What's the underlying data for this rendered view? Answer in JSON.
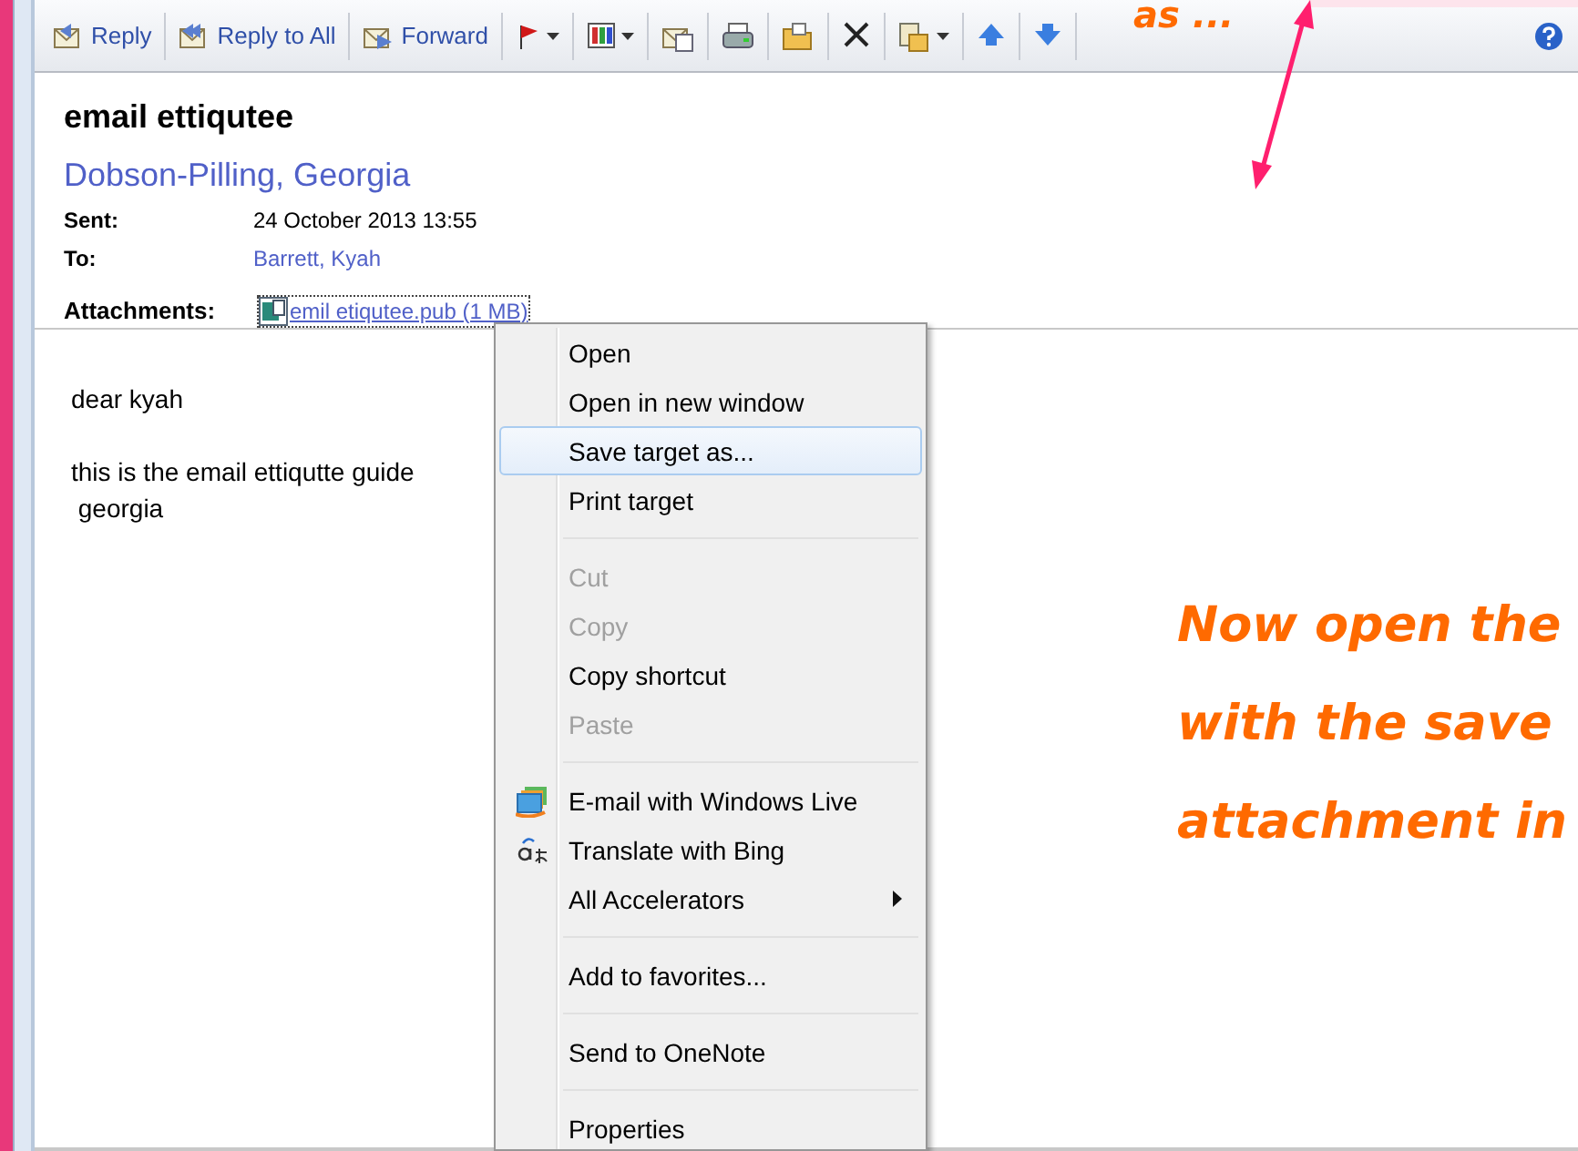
{
  "toolbar": {
    "buttons": [
      {
        "kind": "reply",
        "label": "Reply",
        "dropdown": false
      },
      {
        "kind": "reply-all",
        "label": "Reply to All",
        "dropdown": false
      },
      {
        "kind": "forward",
        "label": "Forward",
        "dropdown": false
      },
      {
        "kind": "flag",
        "dropdown": true
      },
      {
        "kind": "categories",
        "dropdown": true
      },
      {
        "kind": "message",
        "dropdown": false
      },
      {
        "kind": "print",
        "dropdown": false
      },
      {
        "kind": "folder",
        "dropdown": false
      },
      {
        "kind": "delete",
        "dropdown": false
      },
      {
        "kind": "move",
        "dropdown": true
      },
      {
        "kind": "up",
        "dropdown": false
      },
      {
        "kind": "down",
        "dropdown": false
      }
    ],
    "help": true
  },
  "message": {
    "subject": "email ettiqutee",
    "sender": "Dobson-Pilling, Georgia",
    "fields": [
      {
        "label": "Sent:",
        "value": "24 October 2013 13:55",
        "kind": "text"
      },
      {
        "label": "To:",
        "value": "Barrett, Kyah",
        "kind": "link"
      }
    ],
    "attachments": {
      "label": "Attachments:",
      "file": "emil etiqutee.pub (1 MB)"
    },
    "body": [
      {
        "lines": [
          "dear kyah"
        ]
      },
      {
        "lines": [
          "this is the email ettiqutte guide",
          " georgia"
        ]
      }
    ]
  },
  "context_menu": {
    "items": [
      {
        "kind": "item",
        "label": "Open",
        "disabled": false,
        "selected": false
      },
      {
        "kind": "item",
        "label": "Open in new window",
        "disabled": false,
        "selected": false
      },
      {
        "kind": "item",
        "label": "Save target as...",
        "disabled": false,
        "selected": true
      },
      {
        "kind": "item",
        "label": "Print target",
        "disabled": false,
        "selected": false
      },
      {
        "kind": "separator"
      },
      {
        "kind": "item",
        "label": "Cut",
        "disabled": true,
        "selected": false
      },
      {
        "kind": "item",
        "label": "Copy",
        "disabled": true,
        "selected": false
      },
      {
        "kind": "item",
        "label": "Copy shortcut",
        "disabled": false,
        "selected": false
      },
      {
        "kind": "item",
        "label": "Paste",
        "disabled": true,
        "selected": false
      },
      {
        "kind": "separator"
      },
      {
        "kind": "mail",
        "label": "E-mail with Windows Live",
        "disabled": false,
        "selected": false
      },
      {
        "kind": "translate",
        "label": "Translate with Bing",
        "disabled": false,
        "selected": false
      },
      {
        "kind": "item",
        "label": "All Accelerators",
        "disabled": false,
        "selected": false,
        "submenu": true
      },
      {
        "kind": "separator"
      },
      {
        "kind": "item",
        "label": "Add to favorites...",
        "disabled": false,
        "selected": false
      },
      {
        "kind": "separator"
      },
      {
        "kind": "item",
        "label": "Send to OneNote",
        "disabled": false,
        "selected": false
      },
      {
        "kind": "separator"
      },
      {
        "kind": "item",
        "label": "Properties",
        "disabled": false,
        "selected": false
      }
    ]
  },
  "annotations": {
    "top_note": "as ...",
    "note_lines": [
      "Now open the",
      "with the save",
      "attachment in"
    ]
  }
}
